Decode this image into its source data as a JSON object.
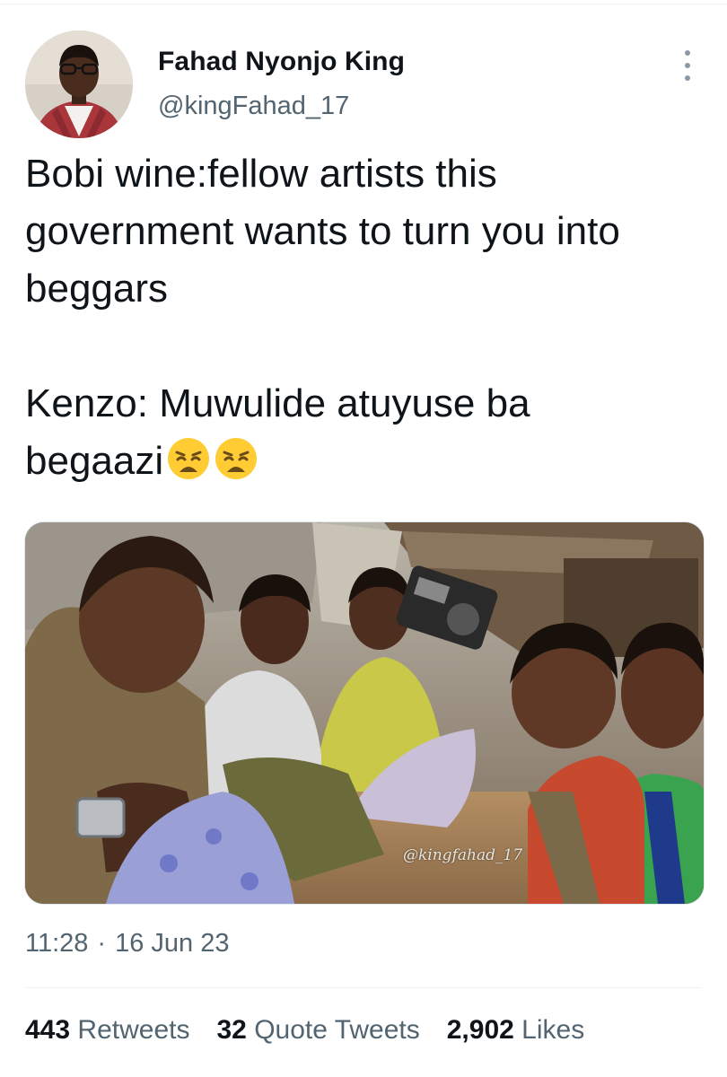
{
  "tweet": {
    "author": {
      "name": "Fahad Nyonjo King",
      "handle": "@kingFahad_17"
    },
    "text_lines": [
      "Bobi wine:fellow artists this",
      "government wants to turn you into",
      "beggars",
      "",
      "Kenzo: Muwulide atuyuse ba",
      "begaazi"
    ],
    "emoji": [
      "weary-face",
      "weary-face"
    ],
    "media": {
      "watermark": "@kingfahad_17",
      "icon": "photo"
    },
    "time": "11:28",
    "separator": "·",
    "date": "16 Jun 23",
    "stats": {
      "retweets_count": "443",
      "retweets_label": "Retweets",
      "quotes_count": "32",
      "quotes_label": "Quote Tweets",
      "likes_count": "2,902",
      "likes_label": "Likes"
    }
  },
  "colors": {
    "text": "#0f1419",
    "secondary": "#536471",
    "divider": "#eff3f4"
  }
}
